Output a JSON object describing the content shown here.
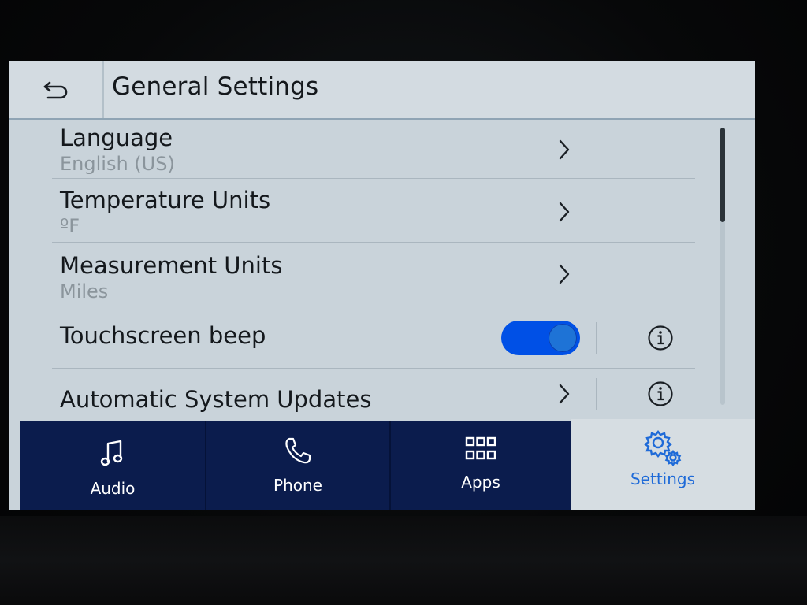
{
  "header": {
    "title": "General Settings",
    "back_icon": "back-arrow-icon"
  },
  "settings": {
    "language": {
      "label": "Language",
      "value": "English (US)"
    },
    "temperature": {
      "label": "Temperature Units",
      "value": "ºF"
    },
    "measurement": {
      "label": "Measurement Units",
      "value": "Miles"
    },
    "touchscreen_beep": {
      "label": "Touchscreen beep",
      "enabled": true
    },
    "system_updates": {
      "label": "Automatic System Updates"
    }
  },
  "nav": {
    "tabs": [
      {
        "label": "Audio",
        "icon": "music-note-icon",
        "active": false
      },
      {
        "label": "Phone",
        "icon": "phone-icon",
        "active": false
      },
      {
        "label": "Apps",
        "icon": "apps-grid-icon",
        "active": false
      },
      {
        "label": "Settings",
        "icon": "gear-icon",
        "active": true
      }
    ]
  },
  "colors": {
    "accent": "#1e6ad8",
    "toggle_on": "#0050e6",
    "nav_bg": "#0b1c4d",
    "screen_bg": "#c9d3da"
  }
}
